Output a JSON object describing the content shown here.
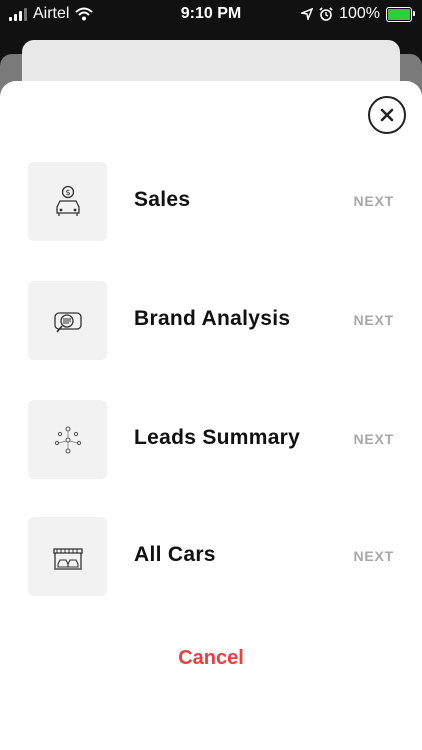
{
  "status_bar": {
    "carrier": "Airtel",
    "time": "9:10 PM",
    "battery": "100%"
  },
  "sheet": {
    "items": [
      {
        "label": "Sales",
        "action": "NEXT",
        "icon": "car-dollar-icon"
      },
      {
        "label": "Brand Analysis",
        "action": "NEXT",
        "icon": "chat-search-icon"
      },
      {
        "label": "Leads Summary",
        "action": "NEXT",
        "icon": "network-nodes-icon"
      },
      {
        "label": "All Cars",
        "action": "NEXT",
        "icon": "car-showroom-icon"
      }
    ],
    "cancel_label": "Cancel"
  },
  "colors": {
    "cancel": "#e8403d",
    "next": "#a8a8a8",
    "tile_bg": "#f2f2f2"
  }
}
